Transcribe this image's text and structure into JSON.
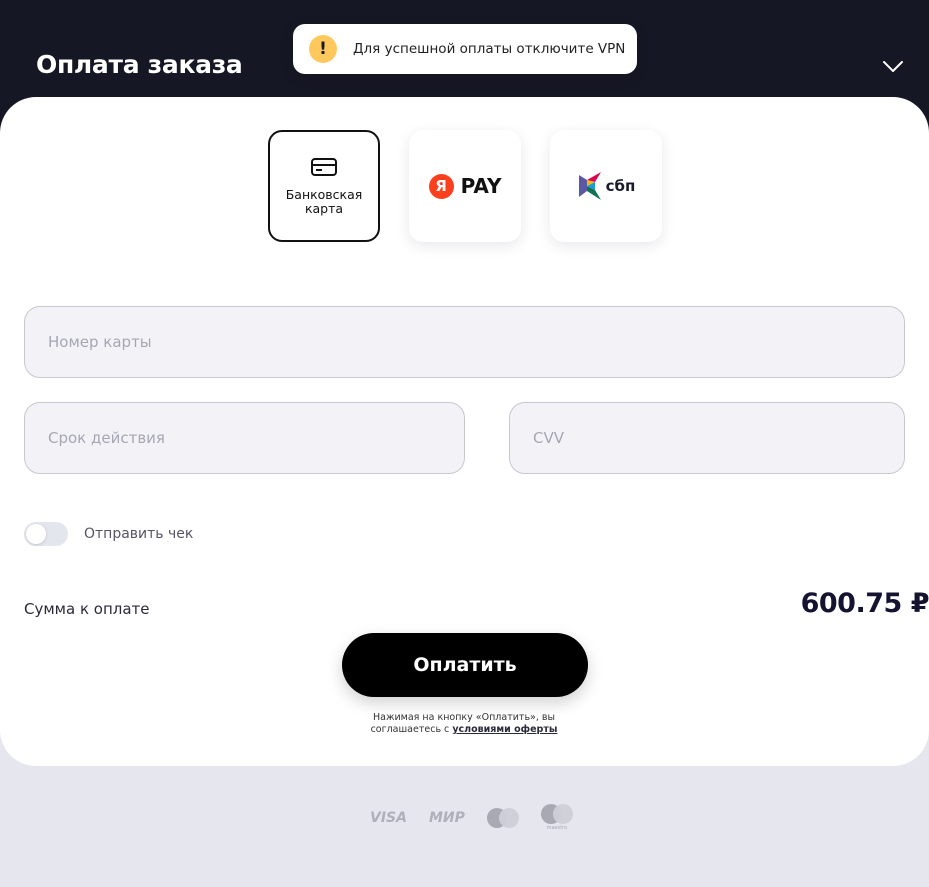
{
  "header": {
    "title": "Оплата заказа"
  },
  "toast": {
    "icon": "!",
    "text": "Для успешной оплаты отключите VPN"
  },
  "payment_methods": {
    "card_label": "Банковская карта",
    "yandex_pay_letter": "Я",
    "yandex_pay_text": "PAY",
    "sbp_text": "сбп"
  },
  "form": {
    "card_number_placeholder": "Номер карты",
    "expiry_placeholder": "Срок действия",
    "cvv_placeholder": "CVV",
    "receipt_toggle_label": "Отправить чек"
  },
  "summary": {
    "label": "Сумма к оплате",
    "amount": "600.75 ₽"
  },
  "pay_button": {
    "label": "Оплатить"
  },
  "legal": {
    "text": "Нажимая на кнопку «Оплатить», вы соглашаетесь с ",
    "link": "условиями оферты"
  },
  "brands": {
    "visa": "VISA",
    "mir": "МИР",
    "maestro": "maestro"
  },
  "colors": {
    "header_bg": "#161724",
    "accent_button": "#000000",
    "toast_icon": "#ffc85c",
    "yandex_red": "#fc3f1d"
  }
}
